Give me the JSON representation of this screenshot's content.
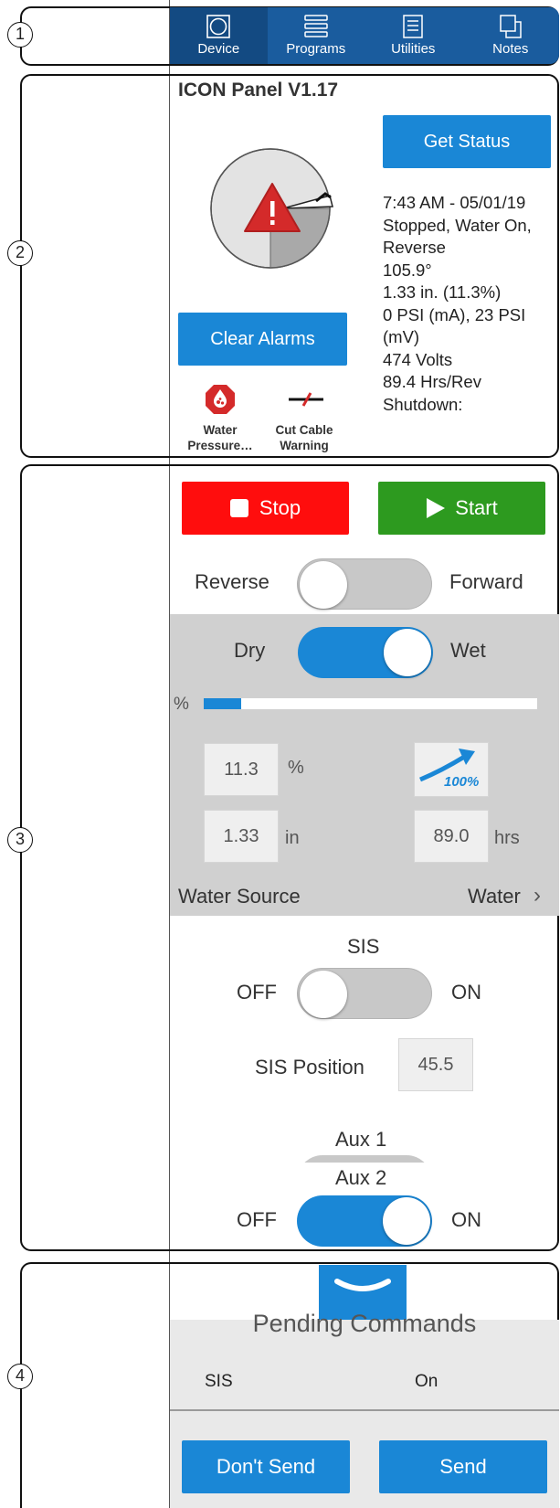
{
  "callouts": [
    "1",
    "2",
    "3",
    "4"
  ],
  "tabs": [
    {
      "label": "Device",
      "icon": "device-icon",
      "active": true
    },
    {
      "label": "Programs",
      "icon": "programs-icon",
      "active": false
    },
    {
      "label": "Utilities",
      "icon": "utilities-icon",
      "active": false
    },
    {
      "label": "Notes",
      "icon": "notes-icon",
      "active": false
    }
  ],
  "panel": {
    "title": "ICON Panel V1.17",
    "get_status": "Get Status",
    "status_lines": [
      "7:43 AM - 05/01/19",
      "Stopped, Water On,",
      "Reverse",
      "105.9°",
      "1.33 in. (11.3%)",
      "0  PSI (mA), 23  PSI",
      "(mV)",
      "474  Volts",
      "89.4 Hrs/Rev",
      "Shutdown:"
    ],
    "clear_alarms": "Clear Alarms",
    "alarms": [
      {
        "line1": "Water",
        "line2": "Pressure…",
        "icon": "water-pressure-icon"
      },
      {
        "line1": "Cut Cable",
        "line2": "Warning",
        "icon": "cut-cable-icon"
      }
    ],
    "gauge_icon": "warning-icon",
    "colors": {
      "alarm_red": "#d42a2a",
      "accent_blue": "#1a87d6"
    }
  },
  "controls": {
    "stop": "Stop",
    "start": "Start",
    "stop_color": "#ff0d0d",
    "start_color": "#2d9a1f",
    "direction": {
      "left": "Reverse",
      "right": "Forward",
      "on": false
    },
    "wet": {
      "left": "Dry",
      "right": "Wet",
      "on": true
    },
    "percent_label": "%",
    "progress": 0.113,
    "percent_value": "11.3",
    "percent_unit": "%",
    "depth_value": "1.33",
    "depth_unit": "in",
    "speed_badge": "100%",
    "hours_value": "89.0",
    "hours_unit": "hrs",
    "water_source_label": "Water Source",
    "water_source_value": "Water",
    "sis": {
      "title": "SIS",
      "off": "OFF",
      "on": "ON",
      "state": false
    },
    "sis_position_label": "SIS Position",
    "sis_position_value": "45.5",
    "aux1": {
      "title": "Aux 1"
    },
    "aux2": {
      "title": "Aux 2",
      "off": "OFF",
      "on": "ON",
      "state": true
    }
  },
  "pending": {
    "title": "Pending Commands",
    "rows": [
      {
        "command": "SIS",
        "value": "On"
      }
    ],
    "dont_send": "Don't Send",
    "send": "Send"
  }
}
